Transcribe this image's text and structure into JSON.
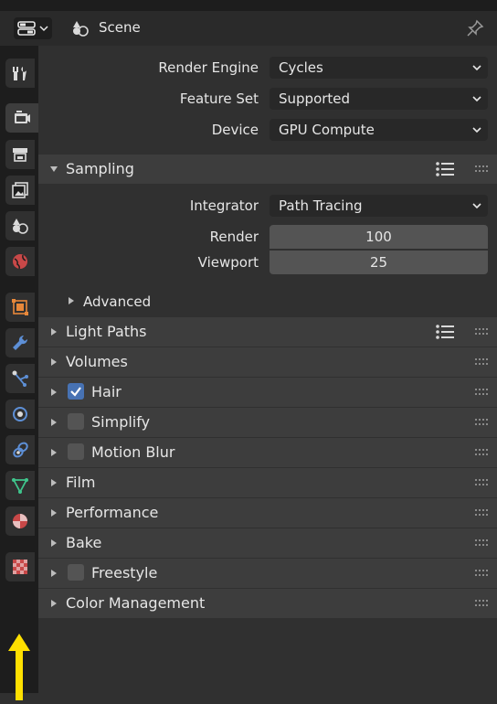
{
  "header": {
    "title": "Scene"
  },
  "sidebar": {
    "tabs": [
      {
        "name": "tool",
        "icon": "tool-icon",
        "color": "#d9d9d9"
      },
      {
        "name": "render",
        "icon": "render-icon",
        "color": "#d9d9d9",
        "active": true
      },
      {
        "name": "output",
        "icon": "output-icon",
        "color": "#d9d9d9"
      },
      {
        "name": "view-layer",
        "icon": "view-layer-icon",
        "color": "#d9d9d9"
      },
      {
        "name": "scene",
        "icon": "scene-icon",
        "color": "#d9d9d9"
      },
      {
        "name": "world",
        "icon": "world-icon",
        "color": "#e05050"
      },
      {
        "name": "object",
        "icon": "object-icon",
        "color": "#e8883a"
      },
      {
        "name": "modifier",
        "icon": "modifier-icon",
        "color": "#5d8fd6"
      },
      {
        "name": "particles",
        "icon": "particles-icon",
        "color": "#5d8fd6"
      },
      {
        "name": "physics",
        "icon": "physics-icon",
        "color": "#5d8fd6"
      },
      {
        "name": "constraints",
        "icon": "constraints-icon",
        "color": "#5d8fd6"
      },
      {
        "name": "data",
        "icon": "mesh-data-icon",
        "color": "#3fc48c"
      },
      {
        "name": "material",
        "icon": "material-icon",
        "color": "#e05050"
      },
      {
        "name": "texture",
        "icon": "texture-icon",
        "color": "#e05050"
      }
    ],
    "highlight_arrow_color": "#ffe000"
  },
  "render": {
    "engine_label": "Render Engine",
    "engine_value": "Cycles",
    "feature_set_label": "Feature Set",
    "feature_set_value": "Supported",
    "device_label": "Device",
    "device_value": "GPU Compute"
  },
  "sampling": {
    "title": "Sampling",
    "integrator_label": "Integrator",
    "integrator_value": "Path Tracing",
    "render_label": "Render",
    "render_value": "100",
    "viewport_label": "Viewport",
    "viewport_value": "25",
    "advanced_label": "Advanced"
  },
  "sections": {
    "light_paths": "Light Paths",
    "volumes": "Volumes",
    "hair": "Hair",
    "simplify": "Simplify",
    "motion_blur": "Motion Blur",
    "film": "Film",
    "performance": "Performance",
    "bake": "Bake",
    "freestyle": "Freestyle",
    "color_management": "Color Management"
  },
  "colors": {
    "accent": "#4772b3",
    "panel": "#303030",
    "header": "#3d3d3d"
  }
}
